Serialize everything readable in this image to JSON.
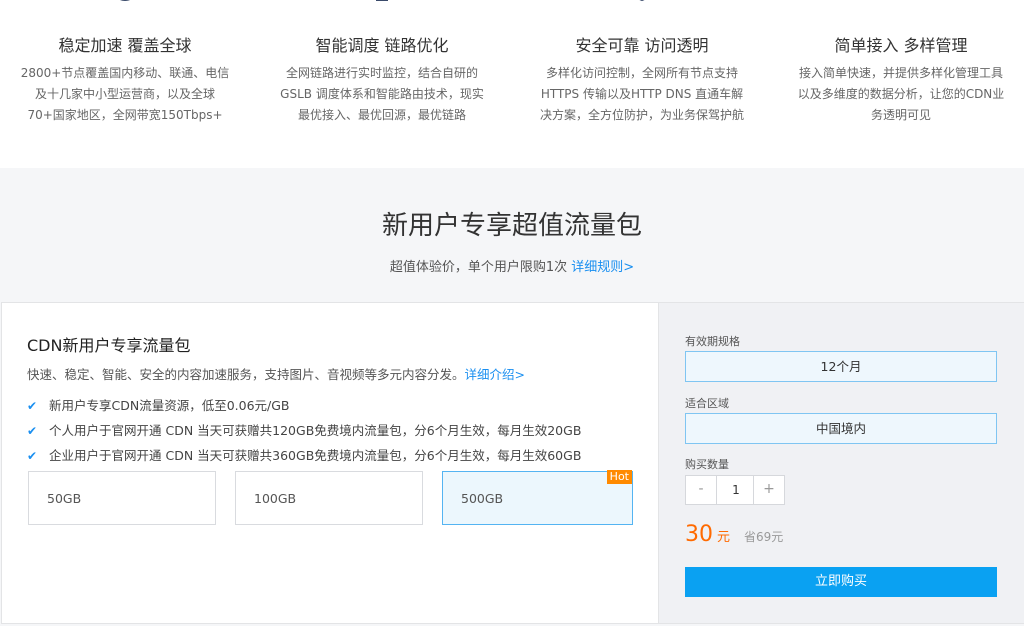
{
  "features": [
    {
      "icon": "globe-icon",
      "title": "稳定加速 覆盖全球",
      "desc": "2800+节点覆盖国内移动、联通、电信及十几家中小型运营商，以及全球70+国家地区，全网带宽150Tbps+"
    },
    {
      "icon": "monitor-icon",
      "title": "智能调度 链路优化",
      "desc": "全网链路进行实时监控，结合自研的GSLB 调度体系和智能路由技术，现实最优接入、最优回源，最优链路"
    },
    {
      "icon": "shield-icon",
      "title": "安全可靠 访问透明",
      "desc": "多样化访问控制，全网所有节点支持HTTPS 传输以及HTTP DNS 直通车解决方案，全方位防护，为业务保驾护航"
    },
    {
      "icon": "gear-icon",
      "title": "简单接入 多样管理",
      "desc": "接入简单快速，并提供多样化管理工具以及多维度的数据分析，让您的CDN业务透明可见"
    }
  ],
  "promo": {
    "title": "新用户专享超值流量包",
    "subtitle": "超值体验价，单个用户限购1次",
    "rules_link": "详细规则>"
  },
  "card": {
    "title": "CDN新用户专享流量包",
    "desc": "快速、稳定、智能、安全的内容加速服务，支持图片、音视频等多元内容分发。",
    "desc_link": "详细介绍>",
    "benefits": [
      "新用户专享CDN流量资源，低至0.06元/GB",
      "个人用户于官网开通 CDN 当天可获赠共120GB免费境内流量包，分6个月生效，每月生效20GB",
      "企业用户于官网开通 CDN 当天可获赠共360GB免费境内流量包，分6个月生效，每月生效60GB"
    ],
    "packages": [
      "50GB",
      "100GB",
      "500GB"
    ],
    "hot_badge": "Hot"
  },
  "order": {
    "period_label": "有效期规格",
    "period_value": "12个月",
    "region_label": "适合区域",
    "region_value": "中国境内",
    "qty_label": "购买数量",
    "qty_minus": "-",
    "qty_value": "1",
    "qty_plus": "+",
    "price": "30",
    "price_unit": "元",
    "saving": "省69元",
    "buy_label": "立即购买"
  },
  "colors": {
    "accent": "#0aa1f2",
    "price": "#ff6a00",
    "hot": "#ff8a00",
    "link": "#1a8ff0"
  }
}
